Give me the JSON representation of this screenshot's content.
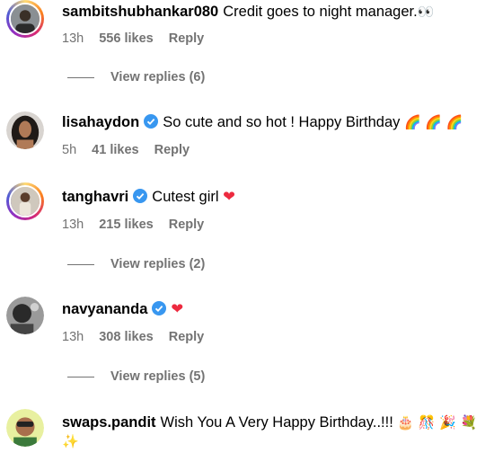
{
  "comments": [
    {
      "username": "sambitshubhankar080",
      "text": "Credit goes to night manager.",
      "emoji": "👀",
      "time": "13h",
      "likes": "556 likes",
      "reply": "Reply",
      "view_replies": "View replies (6)"
    },
    {
      "username": "lisahaydon",
      "verified": true,
      "text": "So cute and so hot ! Happy Birthday",
      "emoji": "🌈 🌈 🌈",
      "time": "5h",
      "likes": "41 likes",
      "reply": "Reply"
    },
    {
      "username": "tanghavri",
      "verified": true,
      "text": "Cutest girl",
      "emoji": "❤",
      "time": "13h",
      "likes": "215 likes",
      "reply": "Reply",
      "view_replies": "View replies (2)"
    },
    {
      "username": "navyananda",
      "verified": true,
      "text": "",
      "emoji": "❤",
      "time": "13h",
      "likes": "308 likes",
      "reply": "Reply",
      "view_replies": "View replies (5)"
    },
    {
      "username": "swaps.pandit",
      "text": "Wish You A Very Happy Birthday..!!!",
      "emoji": "🎂 🎊 🎉 💐",
      "emoji2": "✨"
    }
  ],
  "colors": {
    "meta_text": "#737373",
    "verified": "#3897f0",
    "heart": "#ed2a3f"
  }
}
